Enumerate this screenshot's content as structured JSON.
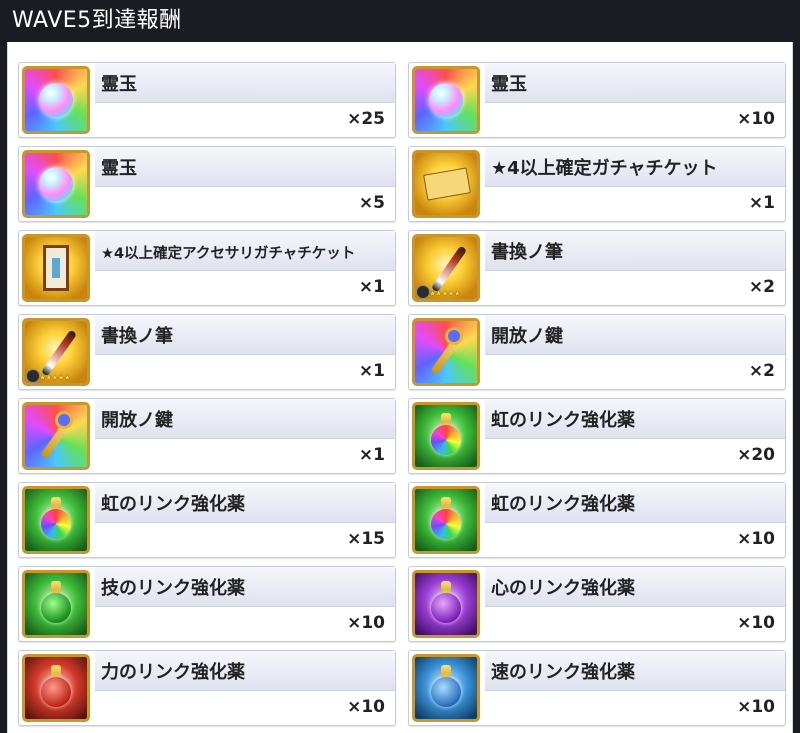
{
  "header": {
    "title": "WAVE5到達報酬"
  },
  "rewards": [
    {
      "name": "霊玉",
      "qty": "×25",
      "icon": "spirit-orb-icon",
      "bg": "rainbow"
    },
    {
      "name": "霊玉",
      "qty": "×10",
      "icon": "spirit-orb-icon",
      "bg": "rainbow"
    },
    {
      "name": "霊玉",
      "qty": "×5",
      "icon": "spirit-orb-icon",
      "bg": "rainbow"
    },
    {
      "name": "★4以上確定ガチャチケット",
      "qty": "×1",
      "icon": "gacha-ticket-icon",
      "bg": "gold"
    },
    {
      "name": "★4以上確定アクセサリガチャチケット",
      "qty": "×1",
      "icon": "accessory-ticket-icon",
      "bg": "gold"
    },
    {
      "name": "書換ノ筆",
      "qty": "×2",
      "icon": "rewrite-brush-icon",
      "bg": "gold",
      "stars": "★★★★★"
    },
    {
      "name": "書換ノ筆",
      "qty": "×1",
      "icon": "rewrite-brush-icon",
      "bg": "gold",
      "stars": "★★★★★"
    },
    {
      "name": "開放ノ鍵",
      "qty": "×2",
      "icon": "release-key-icon",
      "bg": "rainbow"
    },
    {
      "name": "開放ノ鍵",
      "qty": "×1",
      "icon": "release-key-icon",
      "bg": "rainbow"
    },
    {
      "name": "虹のリンク強化薬",
      "qty": "×20",
      "icon": "rainbow-link-potion-icon",
      "bg": "green"
    },
    {
      "name": "虹のリンク強化薬",
      "qty": "×15",
      "icon": "rainbow-link-potion-icon",
      "bg": "green"
    },
    {
      "name": "虹のリンク強化薬",
      "qty": "×10",
      "icon": "rainbow-link-potion-icon",
      "bg": "green"
    },
    {
      "name": "技のリンク強化薬",
      "qty": "×10",
      "icon": "skill-link-potion-icon",
      "bg": "green"
    },
    {
      "name": "心のリンク強化薬",
      "qty": "×10",
      "icon": "heart-link-potion-icon",
      "bg": "purple"
    },
    {
      "name": "力のリンク強化薬",
      "qty": "×10",
      "icon": "power-link-potion-icon",
      "bg": "red"
    },
    {
      "name": "速のリンク強化薬",
      "qty": "×10",
      "icon": "speed-link-potion-icon",
      "bg": "blue"
    }
  ]
}
